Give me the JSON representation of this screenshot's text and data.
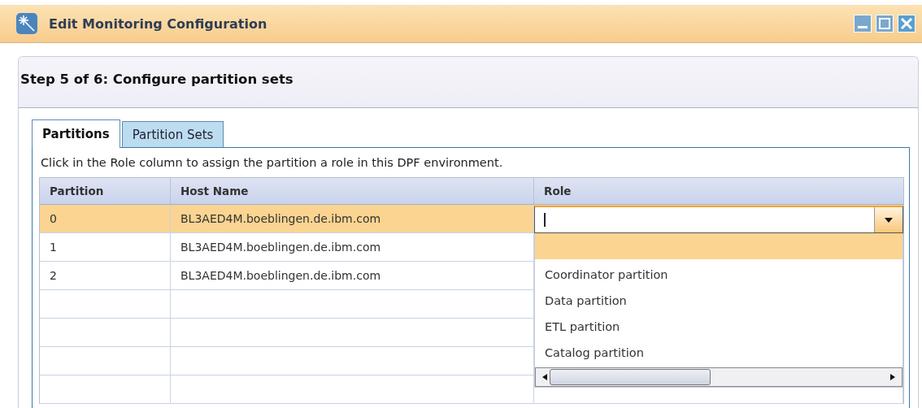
{
  "window": {
    "title": "Edit Monitoring Configuration"
  },
  "step": {
    "title": "Step 5 of 6: Configure partition sets"
  },
  "tabs": [
    {
      "label": "Partitions",
      "selected": true
    },
    {
      "label": "Partition Sets",
      "selected": false
    }
  ],
  "instruction": "Click in the Role column to assign the partition a role in this DPF environment.",
  "table": {
    "columns": [
      "Partition",
      "Host Name",
      "Role"
    ],
    "rows": [
      {
        "partition": "0",
        "host": "BL3AED4M.boeblingen.de.ibm.com",
        "selected": true
      },
      {
        "partition": "1",
        "host": "BL3AED4M.boeblingen.de.ibm.com",
        "selected": false
      },
      {
        "partition": "2",
        "host": "BL3AED4M.boeblingen.de.ibm.com",
        "selected": false
      }
    ]
  },
  "role_dropdown": {
    "expanded": true,
    "options": [
      {
        "kind": "blank",
        "selected": true
      },
      {
        "kind": "option",
        "label": "Coordinator partition",
        "selected": false
      },
      {
        "kind": "option",
        "label": "Data partition",
        "selected": false
      },
      {
        "kind": "option",
        "label": "ETL partition",
        "selected": false
      },
      {
        "kind": "option",
        "label": "Catalog partition",
        "selected": false
      }
    ]
  }
}
